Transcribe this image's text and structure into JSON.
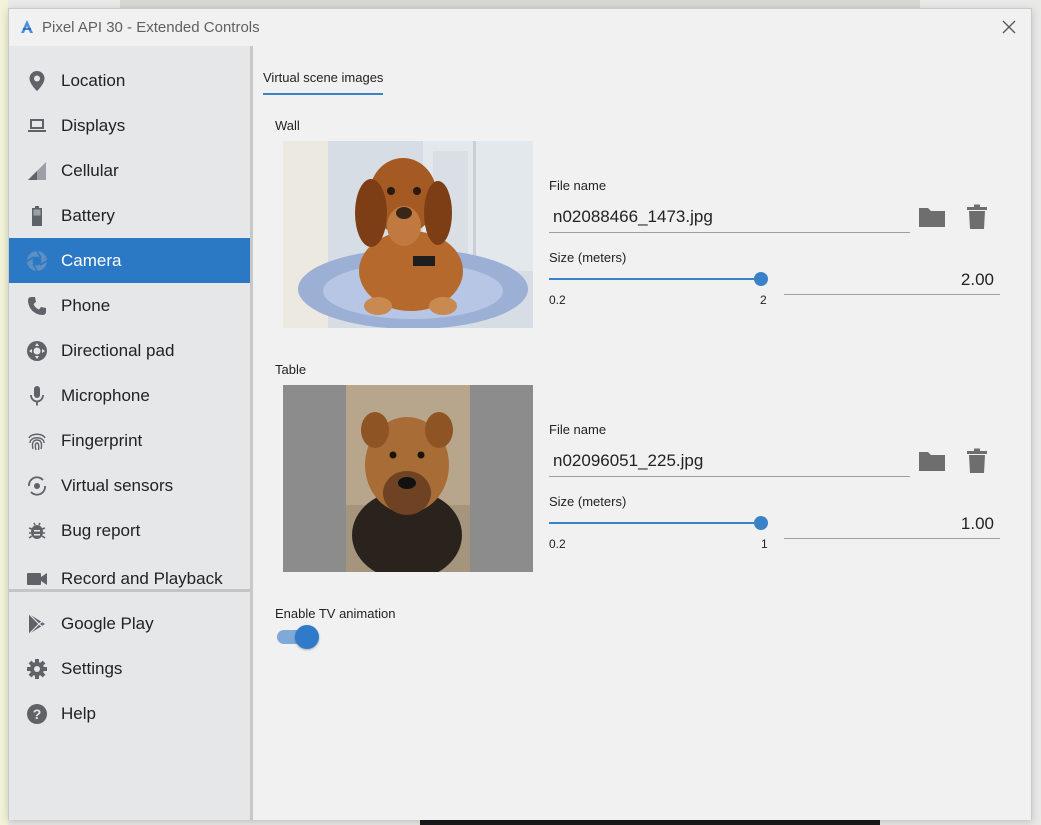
{
  "window": {
    "title": "Pixel API 30 - Extended Controls"
  },
  "sidebar": {
    "items": [
      {
        "label": "Location",
        "icon": "location-pin-icon"
      },
      {
        "label": "Displays",
        "icon": "laptop-icon"
      },
      {
        "label": "Cellular",
        "icon": "signal-icon"
      },
      {
        "label": "Battery",
        "icon": "battery-icon"
      },
      {
        "label": "Camera",
        "icon": "camera-icon",
        "active": true
      },
      {
        "label": "Phone",
        "icon": "phone-icon"
      },
      {
        "label": "Directional pad",
        "icon": "dpad-icon"
      },
      {
        "label": "Microphone",
        "icon": "microphone-icon"
      },
      {
        "label": "Fingerprint",
        "icon": "fingerprint-icon"
      },
      {
        "label": "Virtual sensors",
        "icon": "rotate-icon"
      },
      {
        "label": "Bug report",
        "icon": "bug-icon"
      },
      {
        "label": "Record and Playback",
        "icon": "videocam-icon"
      },
      {
        "label": "Google Play",
        "icon": "play-store-icon"
      },
      {
        "label": "Settings",
        "icon": "gear-icon"
      },
      {
        "label": "Help",
        "icon": "help-icon"
      }
    ]
  },
  "main": {
    "tab": "Virtual scene images",
    "wall": {
      "label": "Wall",
      "file_label": "File name",
      "file_value": "n02088466_1473.jpg",
      "size_label": "Size (meters)",
      "slider_min": "0.2",
      "slider_max": "2",
      "slider_fraction": 1.0,
      "size_value": "2.00"
    },
    "table": {
      "label": "Table",
      "file_label": "File name",
      "file_value": "n02096051_225.jpg",
      "size_label": "Size (meters)",
      "slider_min": "0.2",
      "slider_max": "1",
      "slider_fraction": 1.0,
      "size_value": "1.00"
    },
    "tv_animation": {
      "label": "Enable TV animation",
      "enabled": true
    }
  },
  "colors": {
    "accent": "#2b78c5",
    "sidebar_bg": "#e5e7e8",
    "panel_bg": "#f1f1f1"
  }
}
